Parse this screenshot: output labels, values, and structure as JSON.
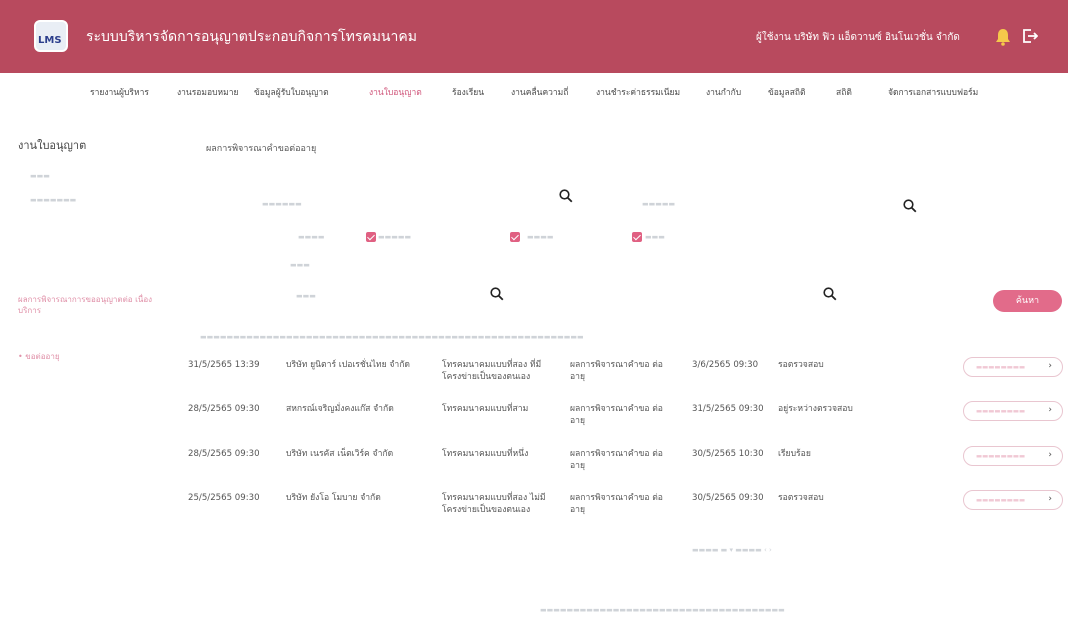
{
  "header": {
    "logo_text": "LMS",
    "title": "ระบบบริหารจัดการอนุญาตประกอบกิจการโทรคมนาคม",
    "user": "ผู้ใช้งาน  บริษัท ฟิว แอ็ดวานซ์ อินโนเวชั่น จำกัด"
  },
  "nav": [
    {
      "label": "รายงานผู้บริหาร",
      "active": false
    },
    {
      "label": "งานรอมอบหมาย",
      "active": false
    },
    {
      "label": "ข้อมูลผู้รับใบอนุญาต",
      "active": false
    },
    {
      "label": "งานใบอนุญาต",
      "active": true
    },
    {
      "label": "ร้องเรียน",
      "active": false
    },
    {
      "label": "งานคลื่นความถี่",
      "active": false
    },
    {
      "label": "งานชำระค่าธรรมเนียม",
      "active": false
    },
    {
      "label": "งานกำกับ",
      "active": false
    },
    {
      "label": "ข้อมูลสถิติ",
      "active": false
    },
    {
      "label": "สถิติ",
      "active": false
    },
    {
      "label": "จัดการเอกสารแบบฟอร์ม",
      "active": false
    }
  ],
  "page": {
    "section_title": "งานใบอนุญาต",
    "form_title": "ผลการพิจารณาคำขอต่ออายุ",
    "side_link": "ผลการพิจารณาการขออนุญาตต่อ เนื่องบริการ",
    "side_item": "• ขอต่ออายุ",
    "search_button": "ค้นหา"
  },
  "table": {
    "rows": [
      {
        "date": "31/5/2565 13:39",
        "company": "บริษัท ยูนิตาร์ เปอเรชั่นไทย จำกัด",
        "service": "โทรคมนาคมแบบที่สอง ที่มีโครงข่ายเป็นของตนเอง",
        "type": "ผลการพิจารณาคำขอ ต่ออายุ",
        "updated": "3/6/2565 09:30",
        "status": "รอตรวจสอบ"
      },
      {
        "date": "28/5/2565 09:30",
        "company": "สหกรณ์เจริญมั่งคงแก๊ส จำกัด",
        "service": "โทรคมนาคมแบบที่สาม",
        "type": "ผลการพิจารณาคำขอ ต่ออายุ",
        "updated": "31/5/2565 09:30",
        "status": "อยู่ระหว่างตรวจสอบ"
      },
      {
        "date": "28/5/2565 09:30",
        "company": "บริษัท เนรคัส เน็ตเวิร์ค จำกัด",
        "service": "โทรคมนาคมแบบที่หนึ่ง",
        "type": "ผลการพิจารณาคำขอ ต่ออายุ",
        "updated": "30/5/2565 10:30",
        "status": "เรียบร้อย"
      },
      {
        "date": "25/5/2565 09:30",
        "company": "บริษัท ยังโอ โมบาย จำกัด",
        "service": "โทรคมนาคมแบบที่สอง ไม่มีโครงข่ายเป็นของตนเอง",
        "type": "ผลการพิจารณาคำขอ ต่ออายุ",
        "updated": "30/5/2565 09:30",
        "status": "รอตรวจสอบ"
      }
    ]
  },
  "icons": {
    "logo": "lms-logo-icon",
    "bell": "bell-icon",
    "logout": "logout-icon",
    "search": "search-icon",
    "checkbox": "checkbox-checked-icon",
    "chevron": "chevron-right-icon"
  },
  "colors": {
    "header": "#b84a5e",
    "accent": "#e06082",
    "bell": "#f5c84b",
    "active_nav": "#d0557a"
  }
}
